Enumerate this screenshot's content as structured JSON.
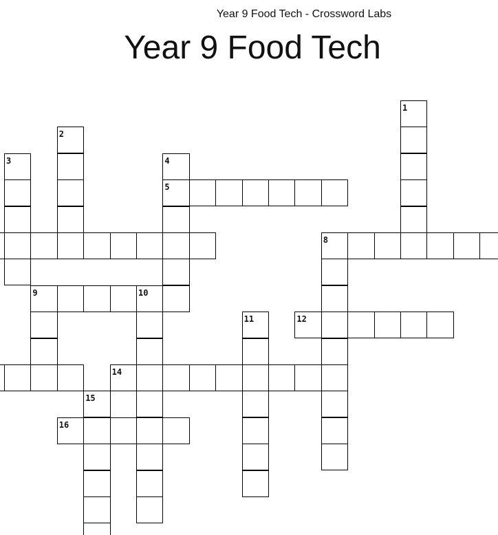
{
  "header": {
    "site_title": "Year 9 Food Tech - Crossword Labs"
  },
  "puzzle": {
    "title": "Year 9 Food Tech",
    "clue_numbers": {
      "c1": "1",
      "c2": "2",
      "c3": "3",
      "c4": "4",
      "c5": "5",
      "c8": "8",
      "c9": "9",
      "c10": "10",
      "c11": "11",
      "c12": "12",
      "c14": "14",
      "c15": "15",
      "c16": "16"
    }
  }
}
